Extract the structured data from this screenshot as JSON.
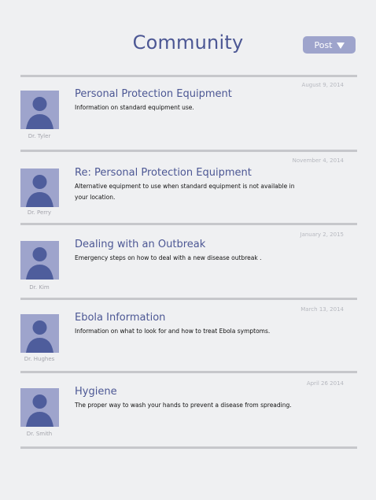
{
  "header": {
    "title": "Community",
    "post_label": "Post"
  },
  "colors": {
    "accent": "#4c5794",
    "avatar_bg": "#9ea4cc",
    "divider": "#c6c7cb"
  },
  "posts": [
    {
      "title": "Personal Protection Equipment",
      "description": "Information on standard equipment use.",
      "author": "Dr. Tyler",
      "date": "August 9, 2014"
    },
    {
      "title": "Re: Personal Protection Equipment",
      "description": "Alternative equipment to use when standard equipment is not available in your location.",
      "author": "Dr. Perry",
      "date": "November 4, 2014"
    },
    {
      "title": "Dealing with an Outbreak",
      "description": "Emergency steps on how to deal with a new disease outbreak .",
      "author": "Dr. Kim",
      "date": "January 2, 2015"
    },
    {
      "title": "Ebola Information",
      "description": "Information on what to look for and how to treat Ebola symptoms.",
      "author": "Dr. Hughes",
      "date": "March 13, 2014"
    },
    {
      "title": "Hygiene",
      "description": "The proper way to wash your hands to prevent a disease from spreading.",
      "author": "Dr. Smith",
      "date": "April 26 2014"
    }
  ]
}
